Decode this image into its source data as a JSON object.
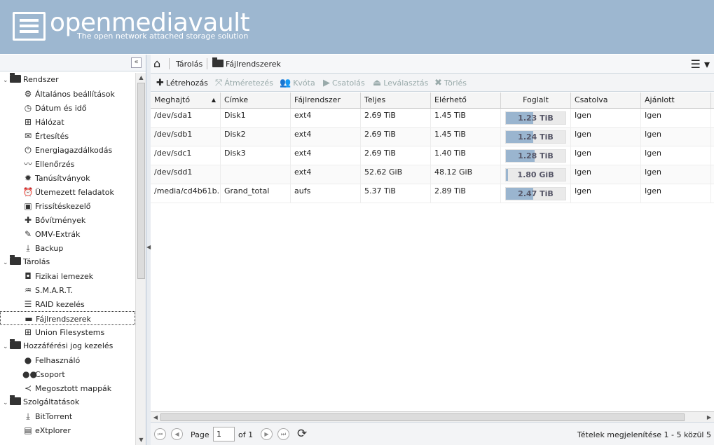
{
  "header": {
    "title": "openmediavault",
    "subtitle": "The open network attached storage solution"
  },
  "sidebar": {
    "collapse_icon": "«",
    "groups": [
      {
        "label": "Rendszer",
        "items": [
          "Általános beállítások",
          "Dátum és idő",
          "Hálózat",
          "Értesítés",
          "Energiagazdálkodás",
          "Ellenőrzés",
          "Tanúsítványok",
          "Ütemezett feladatok",
          "Frissítéskezelő",
          "Bővítmények",
          "OMV-Extrák",
          "Backup"
        ]
      },
      {
        "label": "Tárolás",
        "items": [
          "Fizikai lemezek",
          "S.M.A.R.T.",
          "RAID kezelés",
          "Fájlrendszerek",
          "Union Filesystems"
        ]
      },
      {
        "label": "Hozzáférési jog kezelés",
        "items": [
          "Felhasználó",
          "Csoport",
          "Megosztott mappák"
        ]
      },
      {
        "label": "Szolgáltatások",
        "items": [
          "BitTorrent",
          "eXtplorer"
        ]
      }
    ]
  },
  "breadcrumb": {
    "section": "Tárolás",
    "page": "Fájlrendszerek"
  },
  "toolbar": {
    "create": "Létrehozás",
    "resize": "Átméretezés",
    "quota": "Kvóta",
    "mount": "Csatolás",
    "unmount": "Leválasztás",
    "delete": "Törlés"
  },
  "table": {
    "headers": [
      "Meghajtó",
      "Címke",
      "Fájlrendszer",
      "Teljes",
      "Elérhető",
      "Foglalt",
      "Csatolva",
      "Ajánlott"
    ],
    "rows": [
      {
        "device": "/dev/sda1",
        "label": "Disk1",
        "fs": "ext4",
        "total": "2.69 TiB",
        "available": "1.45 TiB",
        "used": "1.23 TiB",
        "used_fraction": 0.46,
        "mounted": "Igen",
        "referenced": "Igen"
      },
      {
        "device": "/dev/sdb1",
        "label": "Disk2",
        "fs": "ext4",
        "total": "2.69 TiB",
        "available": "1.45 TiB",
        "used": "1.24 TiB",
        "used_fraction": 0.46,
        "mounted": "Igen",
        "referenced": "Igen"
      },
      {
        "device": "/dev/sdc1",
        "label": "Disk3",
        "fs": "ext4",
        "total": "2.69 TiB",
        "available": "1.40 TiB",
        "used": "1.28 TiB",
        "used_fraction": 0.48,
        "mounted": "Igen",
        "referenced": "Igen"
      },
      {
        "device": "/dev/sdd1",
        "label": "",
        "fs": "ext4",
        "total": "52.62 GiB",
        "available": "48.12 GiB",
        "used": "1.80 GiB",
        "used_fraction": 0.03,
        "mounted": "Igen",
        "referenced": "Igen"
      },
      {
        "device": "/media/cd4b61b...",
        "label": "Grand_total",
        "fs": "aufs",
        "total": "5.37 TiB",
        "available": "2.89 TiB",
        "used": "2.47 TiB",
        "used_fraction": 0.46,
        "mounted": "Igen",
        "referenced": "Igen"
      }
    ]
  },
  "pager": {
    "page_label": "Page",
    "page_value": "1",
    "of_label": "of 1",
    "info": "Tételek megjelenítése 1 - 5 közül 5"
  },
  "colors": {
    "header_bg": "#9db7d0",
    "bar_fill": "#9ab5cf"
  }
}
